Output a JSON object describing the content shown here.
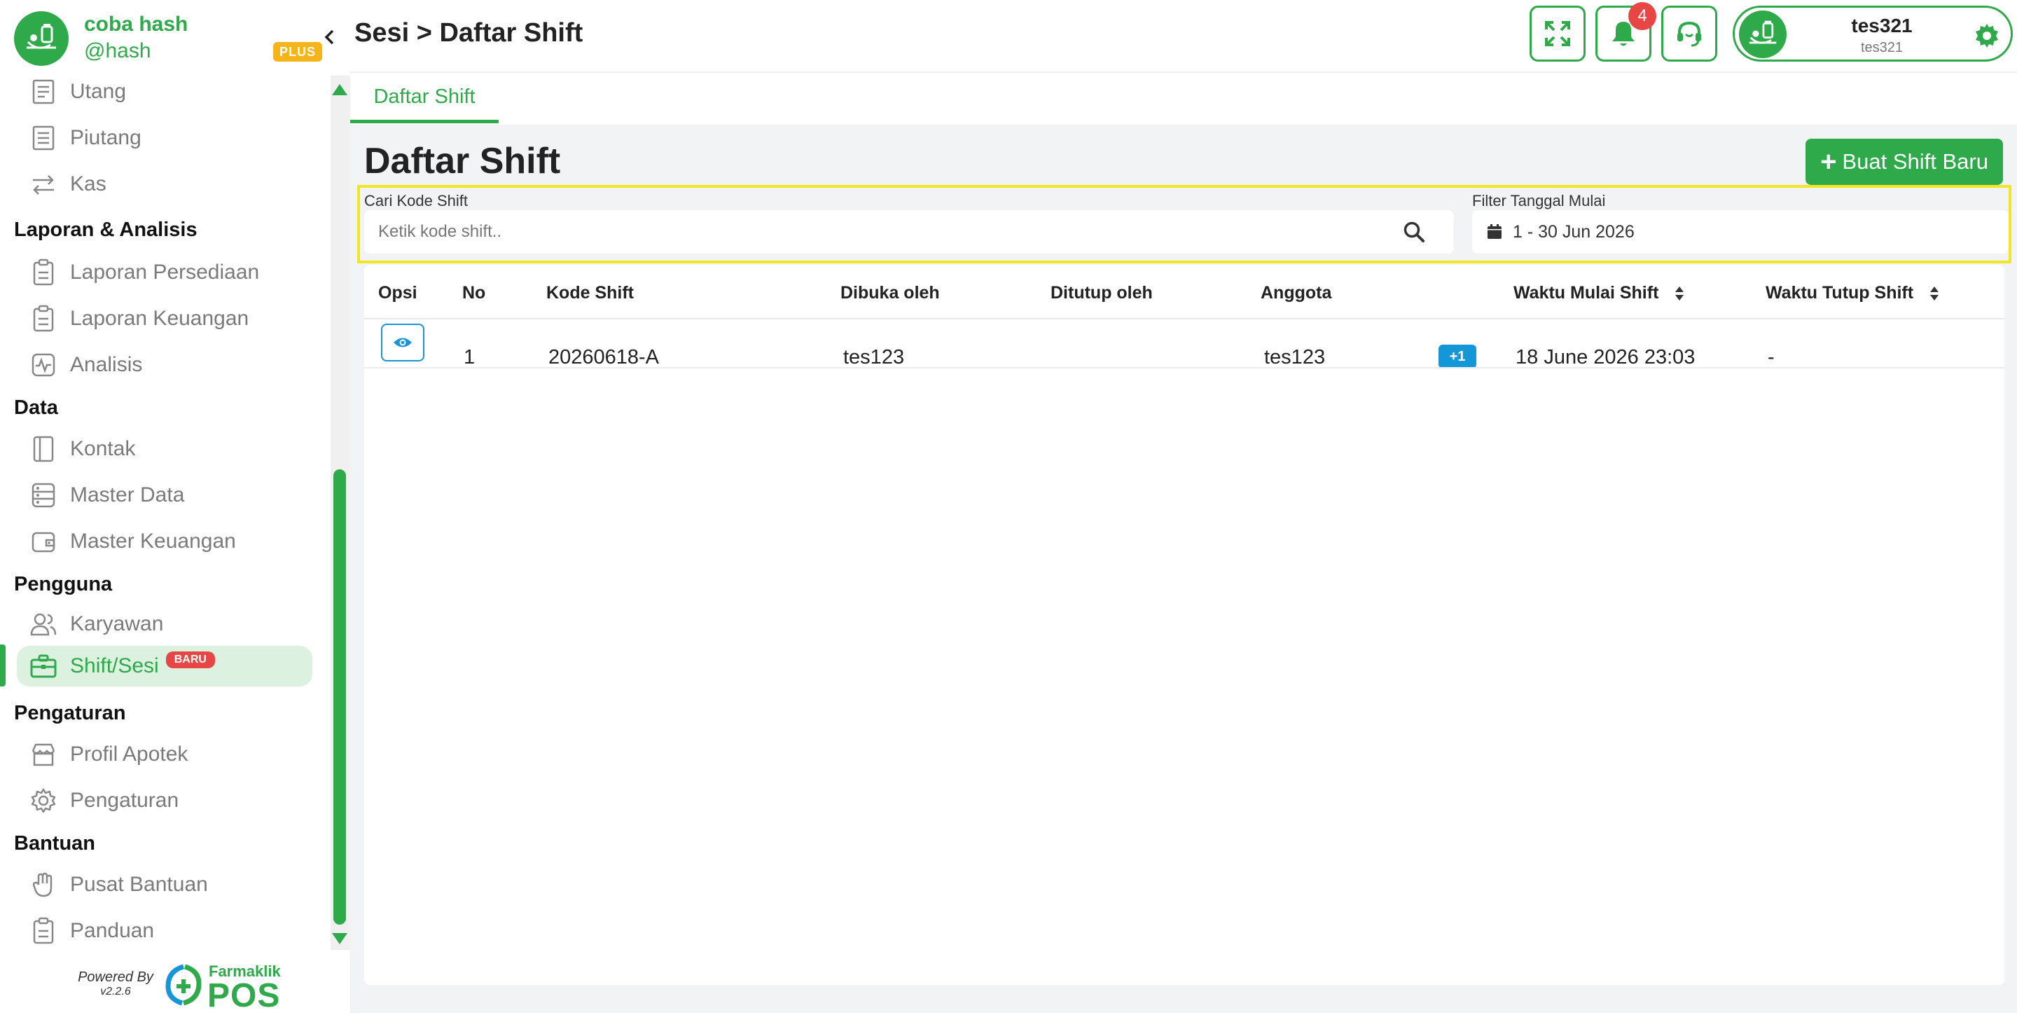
{
  "brand": {
    "name": "coba hash",
    "handle": "@hash",
    "plan_badge": "PLUS"
  },
  "sidebar": {
    "items_top": [
      {
        "label": "Utang",
        "icon": "receipt-icon"
      },
      {
        "label": "Piutang",
        "icon": "invoice-icon"
      },
      {
        "label": "Kas",
        "icon": "transfer-arrows-icon"
      }
    ],
    "sections": [
      {
        "title": "Laporan & Analisis",
        "items": [
          {
            "label": "Laporan Persediaan",
            "icon": "clipboard-icon"
          },
          {
            "label": "Laporan Keuangan",
            "icon": "clipboard-icon"
          },
          {
            "label": "Analisis",
            "icon": "pulse-icon"
          }
        ]
      },
      {
        "title": "Data",
        "items": [
          {
            "label": "Kontak",
            "icon": "contact-book-icon"
          },
          {
            "label": "Master Data",
            "icon": "database-icon"
          },
          {
            "label": "Master Keuangan",
            "icon": "wallet-icon"
          }
        ]
      },
      {
        "title": "Pengguna",
        "items": [
          {
            "label": "Karyawan",
            "icon": "users-icon"
          },
          {
            "label": "Shift/Sesi",
            "icon": "briefcase-icon",
            "badge": "BARU",
            "active": true
          }
        ]
      },
      {
        "title": "Pengaturan",
        "items": [
          {
            "label": "Profil Apotek",
            "icon": "store-icon"
          },
          {
            "label": "Pengaturan",
            "icon": "gear-icon"
          }
        ]
      },
      {
        "title": "Bantuan",
        "items": [
          {
            "label": "Pusat Bantuan",
            "icon": "hand-icon"
          },
          {
            "label": "Panduan",
            "icon": "clipboard-icon"
          }
        ]
      }
    ]
  },
  "footer": {
    "powered_by": "Powered By",
    "version": "v2.2.6",
    "logo_brand": "Farmaklik",
    "logo_text": "POS"
  },
  "header": {
    "breadcrumb": "Sesi > Daftar Shift",
    "notification_count": "4",
    "user_name": "tes321",
    "user_sub": "tes321"
  },
  "tabs": [
    {
      "label": "Daftar Shift",
      "active": true
    }
  ],
  "main": {
    "title": "Daftar Shift",
    "new_button": "Buat Shift Baru",
    "search": {
      "label": "Cari Kode Shift",
      "placeholder": "Ketik kode shift.."
    },
    "date_filter": {
      "label": "Filter Tanggal Mulai",
      "value": "1 - 30 Jun 2026"
    }
  },
  "table": {
    "columns": [
      "Opsi",
      "No",
      "Kode Shift",
      "Dibuka oleh",
      "Ditutup oleh",
      "Anggota",
      "Waktu Mulai Shift",
      "Waktu Tutup Shift"
    ],
    "rows": [
      {
        "no": "1",
        "kode": "20260618-A",
        "dibuka": "tes123",
        "ditutup": "",
        "anggota": "tes123",
        "anggota_extra": "+1",
        "mulai": "18 June 2026 23:03",
        "tutup": "-"
      }
    ]
  },
  "colors": {
    "accent": "#2eaa4a",
    "info": "#1596d6",
    "danger": "#e84545",
    "warning": "#f6b41b",
    "highlight": "#f0e625"
  }
}
